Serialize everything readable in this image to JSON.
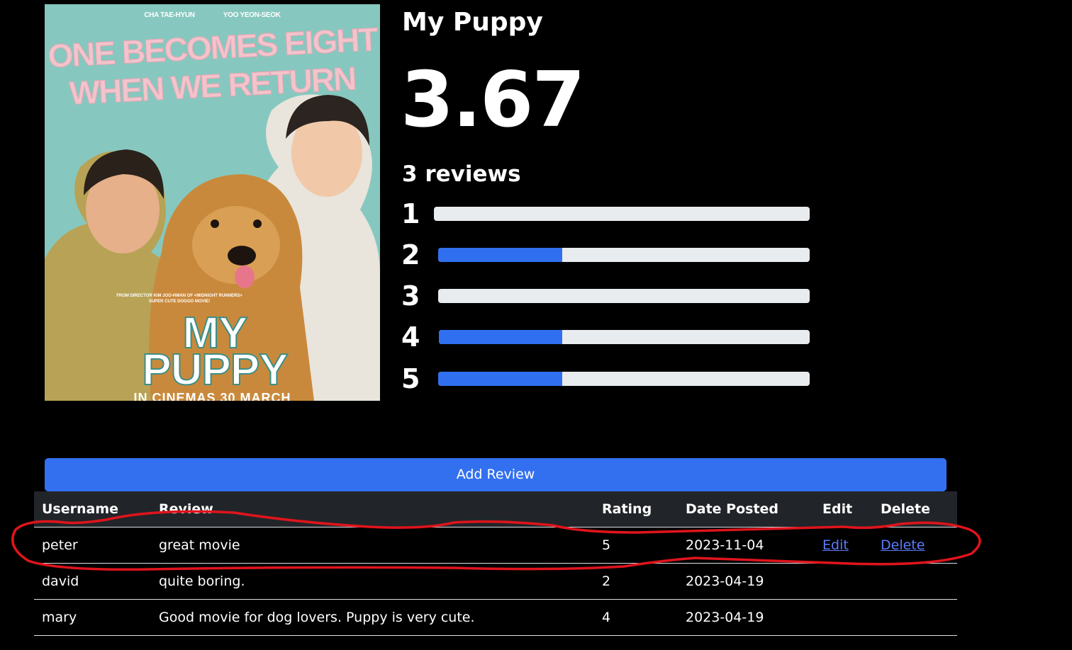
{
  "movie": {
    "title": "My Puppy",
    "average_rating": "3.67",
    "review_count_label": "3 reviews"
  },
  "poster": {
    "credits": [
      "CHA TAE-HYUN",
      "YOO YEON-SEOK"
    ],
    "tagline_line1": "ONE BECOMES EIGHT",
    "tagline_line2": "WHEN WE RETURN",
    "director_line1": "FROM DIRECTOR KIM JOO-HWAN OF <MIDNIGHT RUNNERS>",
    "director_line2": "SUPER CUTE DOGGO MOVIE!",
    "logo_line1": "MY",
    "logo_line2": "PUPPY",
    "release_text": "IN CINEMAS 30 MARCH"
  },
  "distribution": [
    {
      "star": "1",
      "fraction": 0.0
    },
    {
      "star": "2",
      "fraction": 0.3333
    },
    {
      "star": "3",
      "fraction": 0.0
    },
    {
      "star": "4",
      "fraction": 0.3333
    },
    {
      "star": "5",
      "fraction": 0.3333
    }
  ],
  "add_review_label": "Add Review",
  "table": {
    "headers": {
      "username": "Username",
      "review": "Review",
      "rating": "Rating",
      "date": "Date Posted",
      "edit": "Edit",
      "delete": "Delete"
    },
    "rows": [
      {
        "username": "peter",
        "review": "great movie",
        "rating": "5",
        "date": "2023-11-04",
        "edit": "Edit",
        "delete": "Delete"
      },
      {
        "username": "david",
        "review": "quite boring.",
        "rating": "2",
        "date": "2023-04-19",
        "edit": "",
        "delete": ""
      },
      {
        "username": "mary",
        "review": "Good movie for dog lovers. Puppy is very cute.",
        "rating": "4",
        "date": "2023-04-19",
        "edit": "",
        "delete": ""
      }
    ]
  },
  "colors": {
    "page_bg": "#000000",
    "accent": "#3370f0",
    "track": "#e9ecef",
    "table_header_bg": "#212529",
    "link": "#5b7cff",
    "annotation": "#e0141c"
  }
}
